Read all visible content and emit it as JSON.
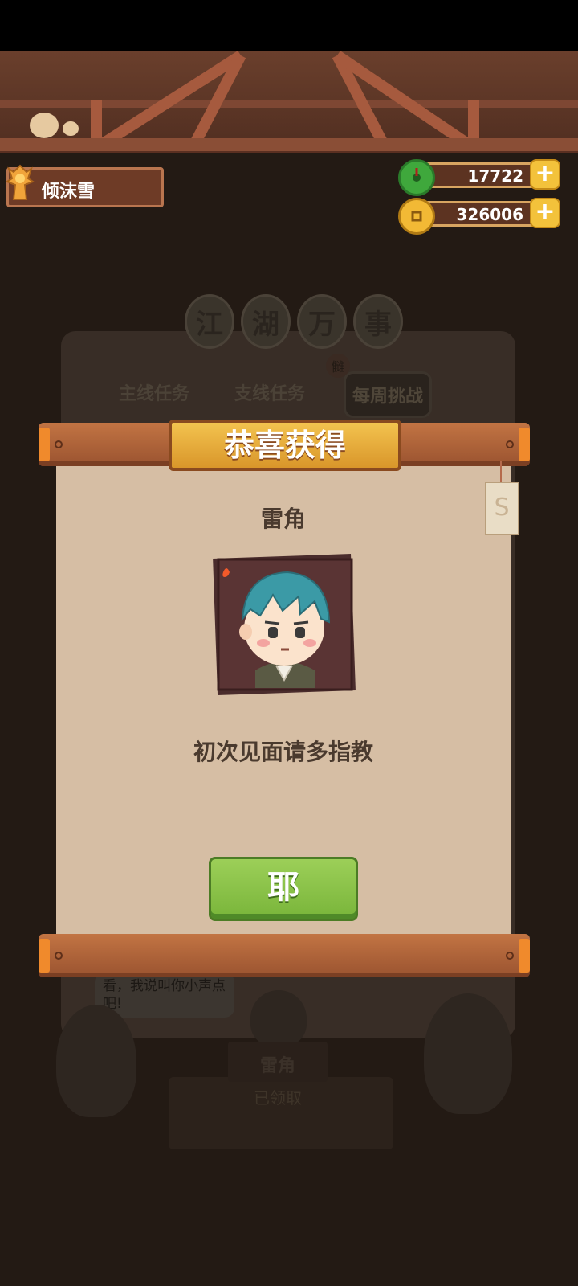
{
  "player": {
    "name": "倾沫雪"
  },
  "currencies": [
    {
      "name": "jade",
      "value": "17722",
      "icon": "jade-coin-icon"
    },
    {
      "name": "gold",
      "value": "326006",
      "icon": "gold-coin-icon"
    }
  ],
  "background": {
    "banner_chars": [
      "江",
      "湖",
      "万",
      "事"
    ],
    "tabs": [
      "主线任务",
      "支线任务",
      "每周挑战"
    ],
    "tab_badge": "雠",
    "speech": "看，我说叫你小声点吧!",
    "desk_name": "雷角",
    "desk_status": "已领取"
  },
  "popup": {
    "title": "恭喜获得",
    "reward_name": "雷角",
    "reward_desc": "初次见面请多指教",
    "confirm_label": "耶",
    "tag_glyph": "S"
  },
  "colors": {
    "paper": "#d6bea4",
    "title_gold": "#f3c34f",
    "button_green": "#8cc34a",
    "wood": "#a85c36"
  }
}
